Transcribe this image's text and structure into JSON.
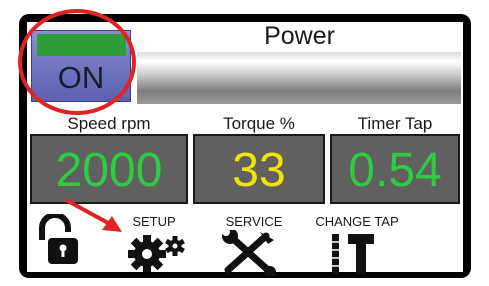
{
  "power": {
    "title": "Power",
    "button_label": "ON",
    "state_color": "#2f9e3a"
  },
  "gauges": [
    {
      "label": "Speed rpm",
      "value": "2000",
      "color": "#2ecc40"
    },
    {
      "label": "Torque %",
      "value": "33",
      "color": "#f2e400"
    },
    {
      "label": "Timer Tap",
      "value": "0.54",
      "color": "#2ecc40"
    }
  ],
  "tools": [
    {
      "label": "",
      "icon": "lock-open-icon"
    },
    {
      "label": "SETUP",
      "icon": "gear-icon"
    },
    {
      "label": "SERVICE",
      "icon": "wrench-screwdriver-icon"
    },
    {
      "label": "CHANGE TAP",
      "icon": "tap-wrench-icon"
    }
  ],
  "annotation_color": "#e02424"
}
